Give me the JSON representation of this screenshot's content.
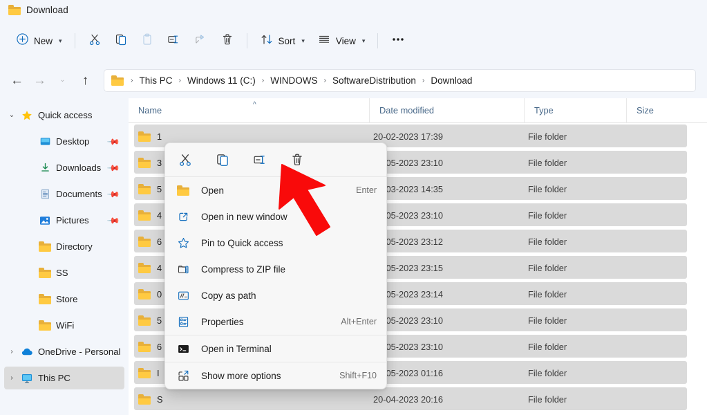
{
  "window": {
    "tab_title": "Download",
    "tab_icon": "folder-icon"
  },
  "toolbar": {
    "new_label": "New",
    "new_icon": "plus-circle-icon",
    "cut_icon": "scissors-icon",
    "copy_icon": "copy-icon",
    "paste_icon": "paste-icon",
    "rename_icon": "rename-icon",
    "share_icon": "share-icon",
    "delete_icon": "trash-icon",
    "sort_label": "Sort",
    "sort_icon": "sort-arrows-icon",
    "view_label": "View",
    "view_icon": "list-lines-icon",
    "more_label": "•••",
    "more_icon": "ellipsis-icon"
  },
  "addressbar": {
    "back_icon": "arrow-left-icon",
    "forward_icon": "arrow-right-icon",
    "recent_icon": "chevron-down-icon",
    "up_icon": "arrow-up-icon",
    "folder_icon": "folder-icon",
    "separator": "›",
    "crumbs": [
      "This PC",
      "Windows 11 (C:)",
      "WINDOWS",
      "SoftwareDistribution",
      "Download"
    ]
  },
  "sidebar": {
    "items": [
      {
        "label": "Quick access",
        "icon": "star-icon",
        "expander": "chevron-down",
        "indent": 0,
        "pinned": false,
        "selected": false
      },
      {
        "label": "Desktop",
        "icon": "desktop-icon",
        "expander": "",
        "indent": 1,
        "pinned": true,
        "selected": false
      },
      {
        "label": "Downloads",
        "icon": "download-arrow-icon",
        "expander": "",
        "indent": 1,
        "pinned": true,
        "selected": false
      },
      {
        "label": "Documents",
        "icon": "document-icon",
        "expander": "",
        "indent": 1,
        "pinned": true,
        "selected": false
      },
      {
        "label": "Pictures",
        "icon": "picture-icon",
        "expander": "",
        "indent": 1,
        "pinned": true,
        "selected": false
      },
      {
        "label": "Directory",
        "icon": "folder-icon",
        "expander": "",
        "indent": 1,
        "pinned": false,
        "selected": false
      },
      {
        "label": "SS",
        "icon": "folder-icon",
        "expander": "",
        "indent": 1,
        "pinned": false,
        "selected": false
      },
      {
        "label": "Store",
        "icon": "folder-icon",
        "expander": "",
        "indent": 1,
        "pinned": false,
        "selected": false
      },
      {
        "label": "WiFi",
        "icon": "folder-icon",
        "expander": "",
        "indent": 1,
        "pinned": false,
        "selected": false
      },
      {
        "label": "OneDrive - Personal",
        "icon": "cloud-icon",
        "expander": "chevron-right",
        "indent": 0,
        "pinned": false,
        "selected": false
      },
      {
        "label": "This PC",
        "icon": "pc-monitor-icon",
        "expander": "chevron-right",
        "indent": 0,
        "pinned": false,
        "selected": true
      }
    ]
  },
  "filelist": {
    "columns": [
      "Name",
      "Date modified",
      "Type",
      "Size"
    ],
    "sort_column": "Name",
    "sort_caret": "^",
    "rows": [
      {
        "name": "1",
        "date": "20-02-2023 17:39",
        "type": "File folder",
        "size": ""
      },
      {
        "name": "3",
        "date": "28-05-2023 23:10",
        "type": "File folder",
        "size": ""
      },
      {
        "name": "5",
        "date": "20-03-2023 14:35",
        "type": "File folder",
        "size": ""
      },
      {
        "name": "4",
        "date": "28-05-2023 23:10",
        "type": "File folder",
        "size": ""
      },
      {
        "name": "6",
        "date": "28-05-2023 23:12",
        "type": "File folder",
        "size": ""
      },
      {
        "name": "4",
        "date": "28-05-2023 23:15",
        "type": "File folder",
        "size": ""
      },
      {
        "name": "0",
        "date": "28-05-2023 23:14",
        "type": "File folder",
        "size": ""
      },
      {
        "name": "5",
        "date": "28-05-2023 23:10",
        "type": "File folder",
        "size": ""
      },
      {
        "name": "6",
        "date": "28-05-2023 23:10",
        "type": "File folder",
        "size": ""
      },
      {
        "name": "I",
        "date": "25-05-2023 01:16",
        "type": "File folder",
        "size": ""
      },
      {
        "name": "S",
        "date": "20-04-2023 20:16",
        "type": "File folder",
        "size": ""
      }
    ]
  },
  "context_menu": {
    "icon_buttons": [
      {
        "name": "cut",
        "icon": "scissors-icon"
      },
      {
        "name": "copy",
        "icon": "copy-icon"
      },
      {
        "name": "rename",
        "icon": "rename-icon"
      },
      {
        "name": "delete",
        "icon": "trash-icon"
      }
    ],
    "items": [
      {
        "label": "Open",
        "accel": "Enter",
        "icon": "folder-icon"
      },
      {
        "label": "Open in new window",
        "accel": "",
        "icon": "open-external-icon"
      },
      {
        "label": "Pin to Quick access",
        "accel": "",
        "icon": "star-outline-icon"
      },
      {
        "label": "Compress to ZIP file",
        "accel": "",
        "icon": "zip-folder-icon"
      },
      {
        "label": "Copy as path",
        "accel": "",
        "icon": "copy-path-icon"
      },
      {
        "label": "Properties",
        "accel": "Alt+Enter",
        "icon": "properties-icon"
      },
      {
        "label": "Open in Terminal",
        "accel": "",
        "icon": "terminal-icon"
      },
      {
        "label": "Show more options",
        "accel": "Shift+F10",
        "icon": "more-options-icon"
      }
    ]
  },
  "annotation": {
    "arrow_color": "#f90a0a",
    "arrow_target": "delete-icon"
  },
  "colors": {
    "chrome": "#f3f6fb",
    "accent": "#0f6cbd",
    "folder_yellow": "#ffca42",
    "row_bg": "#dadada",
    "selected_nav": "#dcdcdc",
    "header_text": "#4a6a8a"
  }
}
